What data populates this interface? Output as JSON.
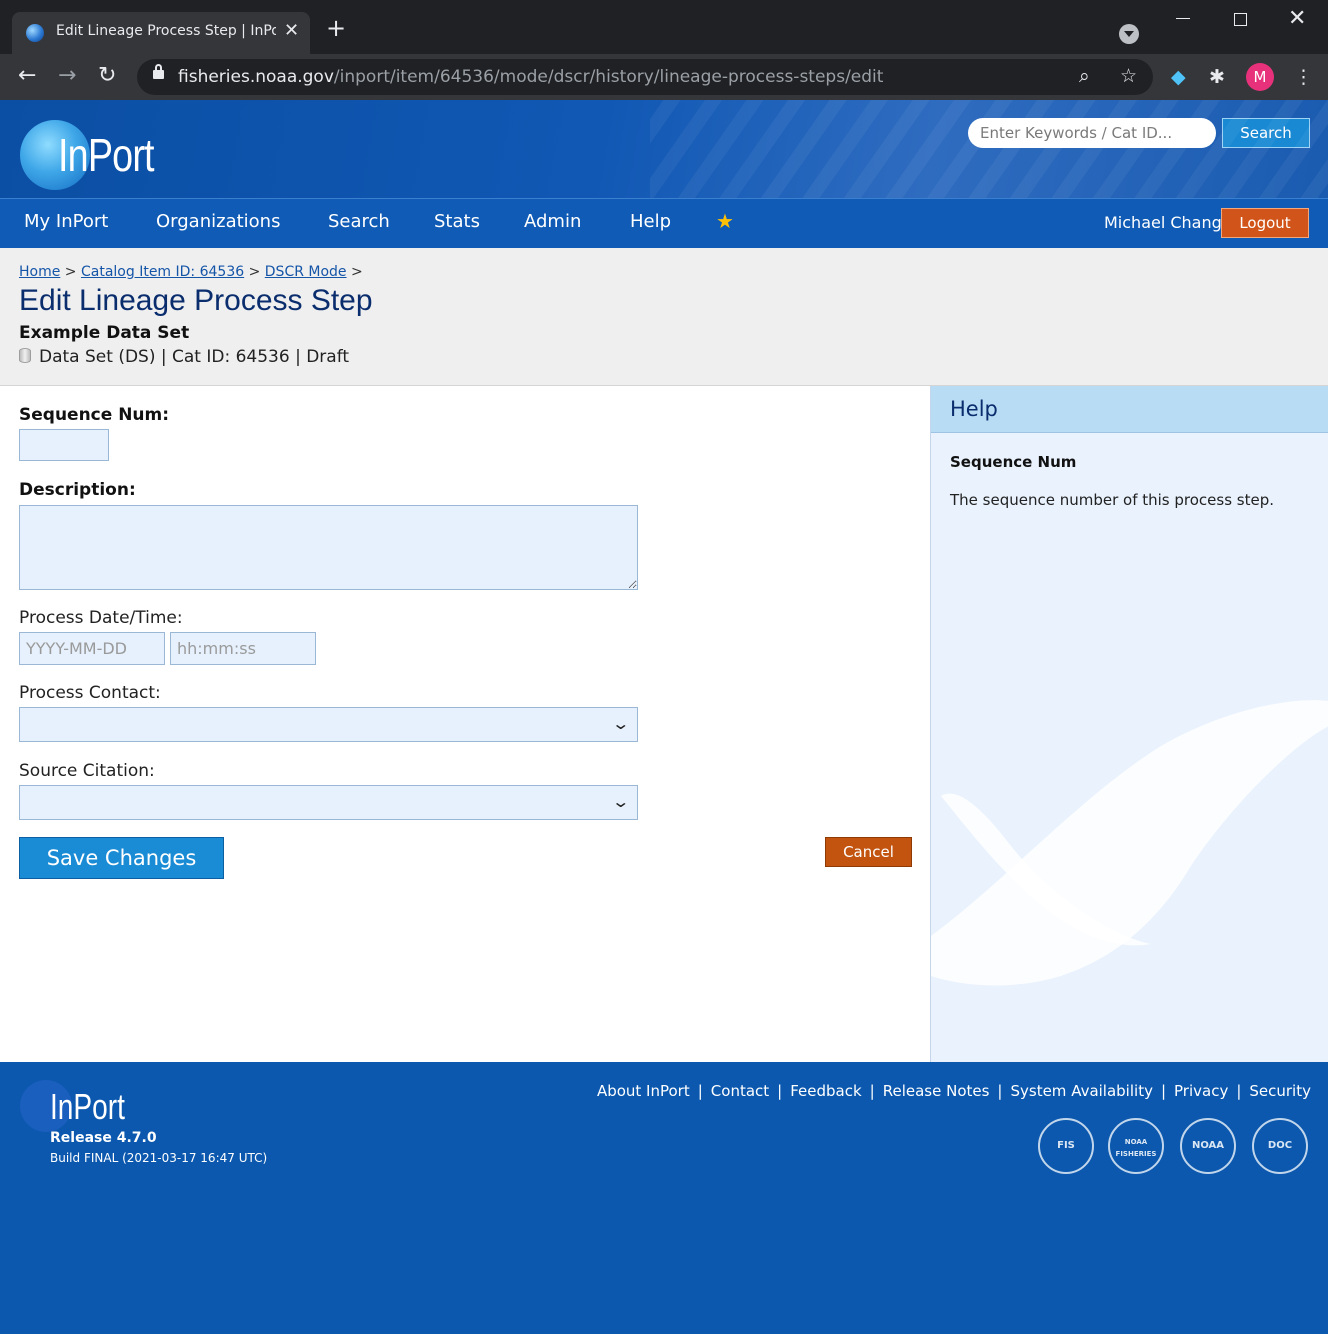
{
  "browser": {
    "tab_title": "Edit Lineage Process Step | InPort",
    "url_host": "fisheries.noaa.gov",
    "url_path": "/inport/item/64536/mode/dscr/history/lineage-process-steps/edit",
    "profile_initial": "M"
  },
  "header": {
    "logo_text": "InPort",
    "search_placeholder": "Enter Keywords / Cat ID...",
    "search_button": "Search"
  },
  "nav": {
    "items": [
      "My InPort",
      "Organizations",
      "Search",
      "Stats",
      "Admin",
      "Help"
    ],
    "user": "Michael Chang",
    "logout": "Logout"
  },
  "breadcrumb": {
    "home": "Home",
    "catalog_item": "Catalog Item ID: 64536",
    "mode": "DSCR Mode",
    "sep": ">"
  },
  "page": {
    "title": "Edit Lineage Process Step",
    "item_name": "Example Data Set",
    "item_meta": "Data Set (DS) | Cat ID: 64536 | Draft"
  },
  "form": {
    "sequence_label": "Sequence Num:",
    "sequence_value": "",
    "description_label": "Description:",
    "description_value": "",
    "date_label": "Process Date/Time:",
    "date_placeholder": "YYYY-MM-DD",
    "time_placeholder": "hh:mm:ss",
    "contact_label": "Process Contact:",
    "contact_value": "",
    "citation_label": "Source Citation:",
    "citation_value": "",
    "save_button": "Save Changes",
    "cancel_button": "Cancel"
  },
  "help": {
    "title": "Help",
    "field": "Sequence Num",
    "text": "The sequence number of this process step."
  },
  "footer": {
    "logo_text": "InPort",
    "release": "Release 4.7.0",
    "build": "Build FINAL (2021-03-17 16:47 UTC)",
    "links": [
      "About InPort",
      "Contact",
      "Feedback",
      "Release Notes",
      "System Availability",
      "Privacy",
      "Security"
    ],
    "seals": [
      "FIS",
      "NOAA FISHERIES",
      "NOAA",
      "DOC"
    ]
  },
  "colors": {
    "header_blue": "#0b4fa4",
    "nav_blue": "#0f5bb5",
    "save_blue": "#1a8bd5",
    "logout_orange": "#d1541a",
    "cancel_orange": "#c25410",
    "title_navy": "#0a2d6e"
  }
}
